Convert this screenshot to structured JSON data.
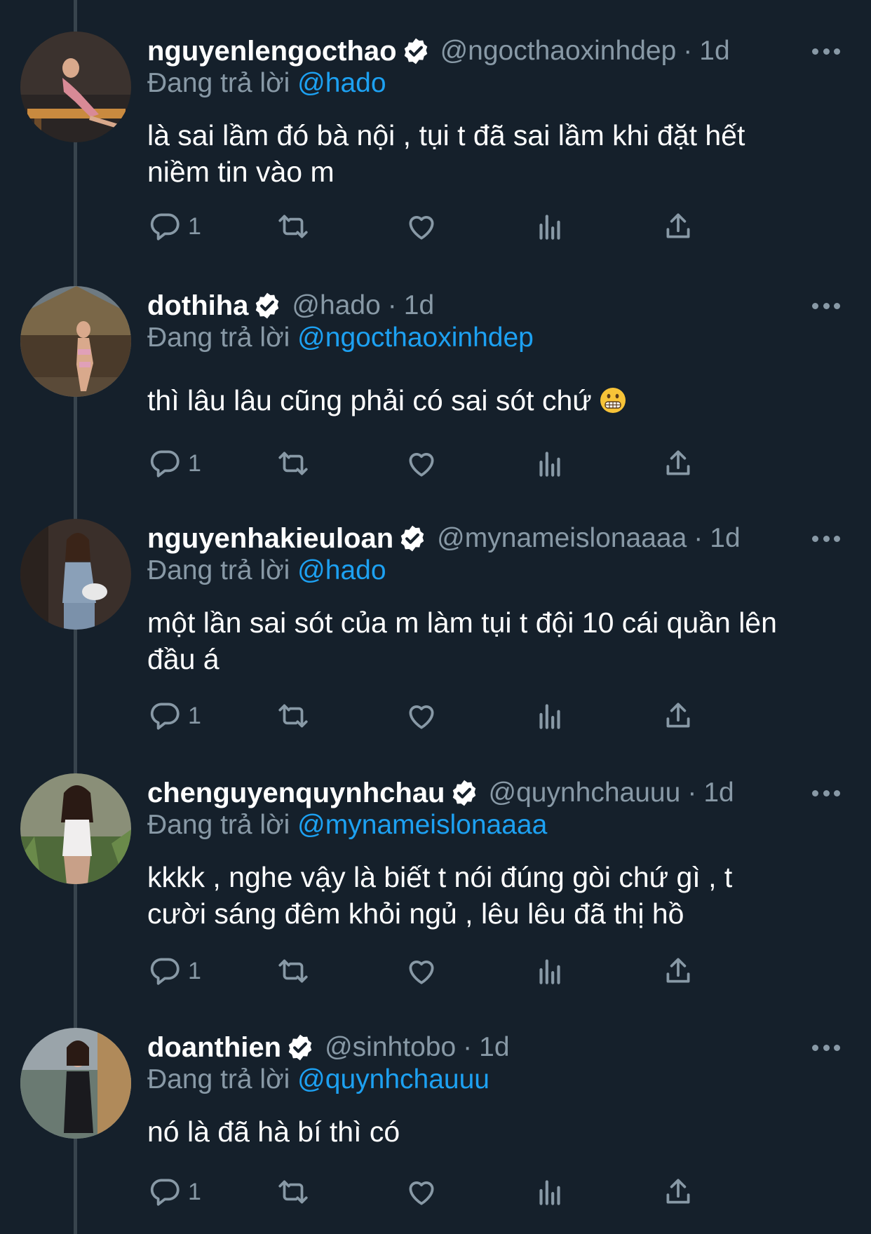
{
  "reply_prefix": "Đang trả lời",
  "colors": {
    "background": "#15202b",
    "text": "#ffffff",
    "muted": "#8899a6",
    "link": "#1da1f2",
    "thread_line": "#38444d"
  },
  "tweets": [
    {
      "display_name": "nguyenlengocthao",
      "handle": "@ngocthaoxinhdep",
      "separator": "·",
      "time": "1d",
      "replying_to": "@hado",
      "text_lines": [
        "là sai lầm đó bà nội , tụi t đã sai lầm khi đặt hết",
        "niềm tin vào m"
      ],
      "reply_count": "1"
    },
    {
      "display_name": "dothiha",
      "handle": "@hado",
      "separator": "·",
      "time": "1d",
      "replying_to": "@ngocthaoxinhdep",
      "text_lines": [
        "thì lâu lâu cũng phải có sai sót chứ"
      ],
      "emoji": "grimacing-face",
      "reply_count": "1"
    },
    {
      "display_name": "nguyenhakieuloan",
      "handle": "@mynameislonaaaa",
      "separator": "·",
      "time": "1d",
      "replying_to": "@hado",
      "text_lines": [
        "một lần sai sót của m làm tụi t đội 10 cái quần lên",
        "đầu á"
      ],
      "reply_count": "1"
    },
    {
      "display_name": "chenguyenquynhchau",
      "handle": "@quynhchauuu",
      "separator": "·",
      "time": "1d",
      "replying_to": "@mynameislonaaaa",
      "text_lines": [
        "kkkk , nghe vậy là biết t nói đúng gòi chứ gì , t",
        "cười sáng đêm khỏi ngủ , lêu lêu đã thị hồ"
      ],
      "reply_count": "1"
    },
    {
      "display_name": "doanthien",
      "handle": "@sinhtobo",
      "separator": "·",
      "time": "1d",
      "replying_to": "@quynhchauuu",
      "text_lines": [
        "nó là đã hà bí thì có"
      ],
      "reply_count": "1"
    }
  ]
}
